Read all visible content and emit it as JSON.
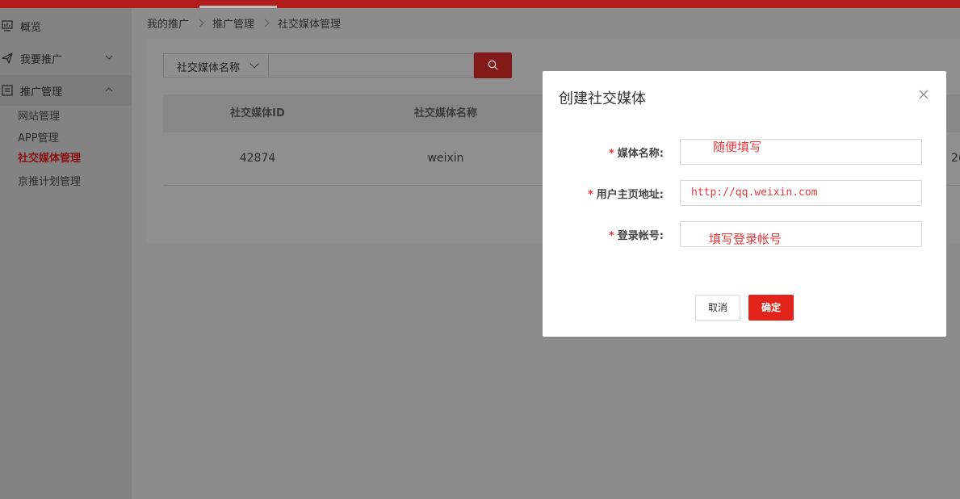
{
  "sidebar": {
    "items": [
      {
        "label": "概览",
        "icon": "chart-icon"
      },
      {
        "label": "我要推广",
        "icon": "send-icon",
        "chevron": "down"
      },
      {
        "label": "推广管理",
        "icon": "document-icon",
        "chevron": "up"
      }
    ],
    "subitems": [
      "网站管理",
      "APP管理",
      "社交媒体管理",
      "京推计划管理"
    ],
    "active_subitem": "社交媒体管理"
  },
  "breadcrumb": [
    "我的推广",
    "推广管理",
    "社交媒体管理"
  ],
  "filter": {
    "select_value": "社交媒体名称",
    "search_value": ""
  },
  "table": {
    "columns": [
      "社交媒体ID",
      "社交媒体名称"
    ],
    "rows": [
      {
        "id": "42874",
        "name": "weixin",
        "partial": "2("
      }
    ]
  },
  "modal": {
    "title": "创建社交媒体",
    "fields": [
      {
        "label": "媒体名称:",
        "required": "*",
        "value": "",
        "annotation": "随便填写"
      },
      {
        "label": "用户主页地址:",
        "required": "*",
        "value": "http://qq.weixin.com",
        "annotation": ""
      },
      {
        "label": "登录帐号:",
        "required": "*",
        "value": "",
        "annotation": "填写登录帐号"
      }
    ],
    "cancel_label": "取消",
    "ok_label": "确定"
  },
  "colors": {
    "brand_red": "#e2231a",
    "overlay_gray": "#8c8c8c"
  }
}
